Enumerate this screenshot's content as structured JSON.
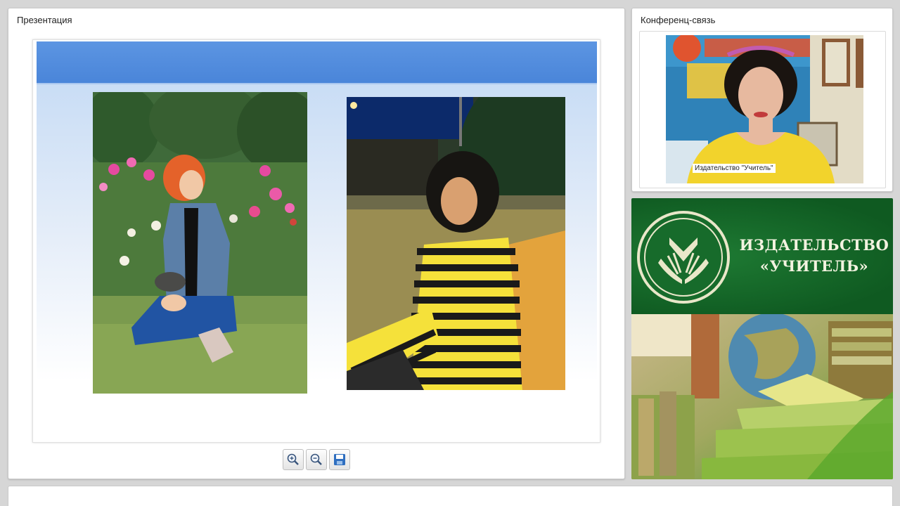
{
  "presentation": {
    "title": "Презентация",
    "toolbar": {
      "zoom_in": "zoom-in-icon",
      "zoom_out": "zoom-out-icon",
      "save": "save-icon"
    }
  },
  "conference": {
    "title": "Конференц-связь",
    "video_caption": "Издательство \"Учитель\""
  },
  "branding": {
    "name_line1": "ИЗДАТЕЛЬСТВО",
    "name_line2": "«УЧИТЕЛЬ»"
  },
  "colors": {
    "slide_header": "#4a85d9",
    "brand_green": "#0f5a21",
    "brand_text": "#f3f3e0"
  }
}
